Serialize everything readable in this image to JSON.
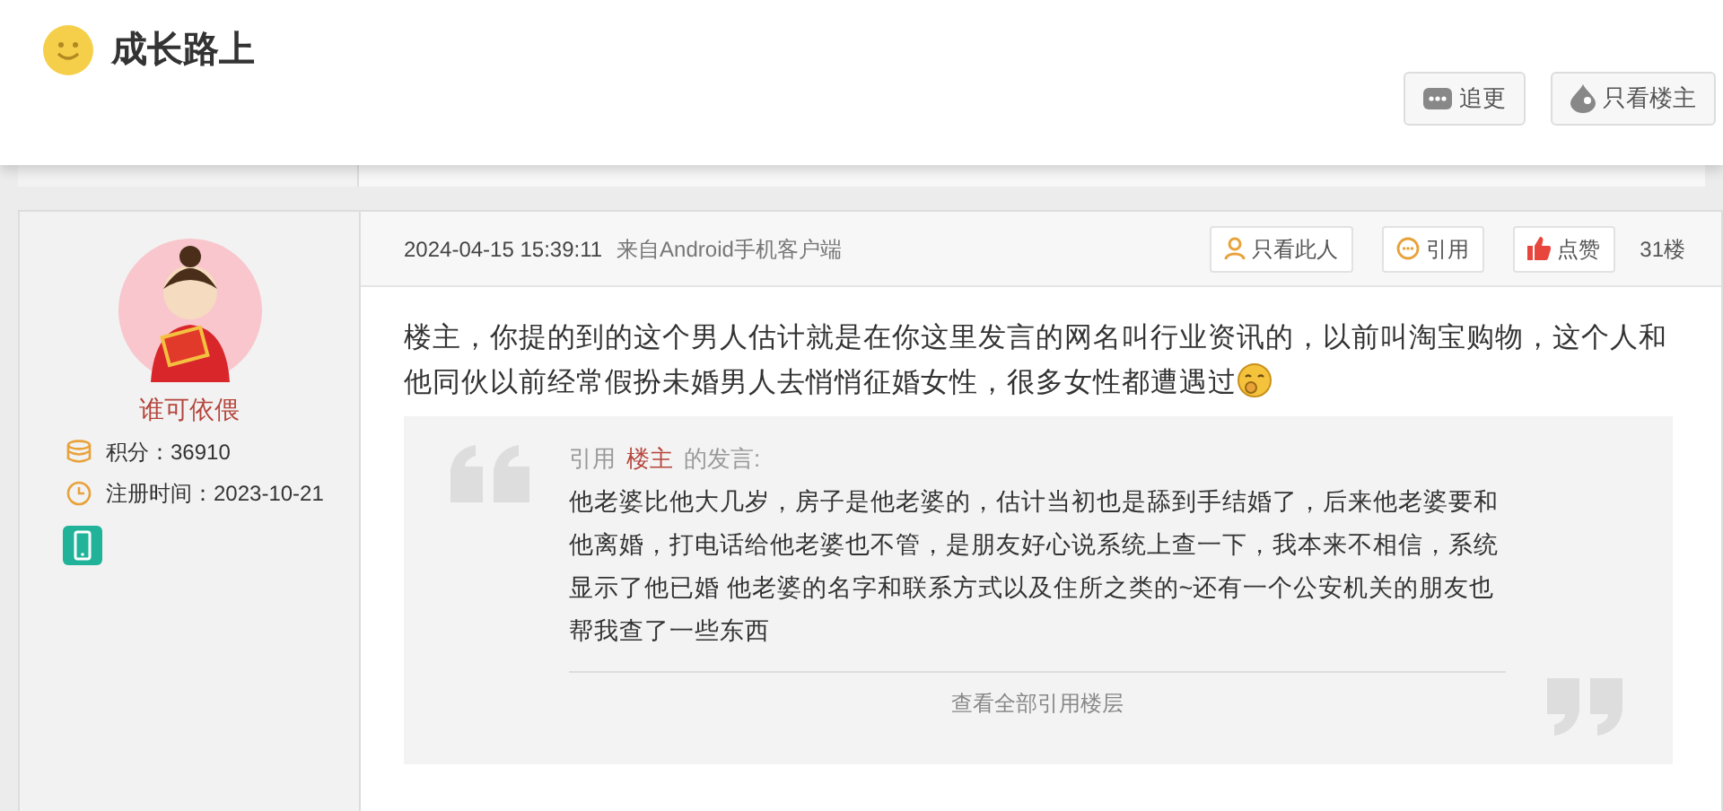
{
  "thread": {
    "title": "成长路上",
    "buttons": [
      {
        "kind": "follow",
        "label": "追更"
      },
      {
        "kind": "author_only",
        "label": "只看楼主"
      }
    ]
  },
  "post": {
    "author": {
      "name": "谁可依偎",
      "points": "积分：36910",
      "registered": "注册时间：2023-10-21"
    },
    "time": "2024-04-15 15:39:11",
    "source": "来自Android手机客户端",
    "actions": [
      {
        "kind": "person",
        "label": "只看此人"
      },
      {
        "kind": "quote",
        "label": "引用"
      },
      {
        "kind": "like",
        "label": "点赞"
      }
    ],
    "floor": "31楼",
    "text": "楼主，你提的到的这个男人估计就是在你这里发言的网名叫行业资讯的，以前叫淘宝购物，这个人和他同伙以前经常假扮未婚男人去悄悄征婚女性，很多女性都遭遇过",
    "quote": {
      "prefix": "引用",
      "author": "楼主",
      "suffix": "的发言:",
      "text": "他老婆比他大几岁，房子是他老婆的，估计当初也是舔到手结婚了，后来他老婆要和他离婚，打电话给他老婆也不管，是朋友好心说系统上查一下，我本来不相信，系统显示了他已婚 他老婆的名字和联系方式以及住所之类的~还有一个公安机关的朋友也帮我查了一些东西",
      "more": "查看全部引用楼层"
    }
  }
}
